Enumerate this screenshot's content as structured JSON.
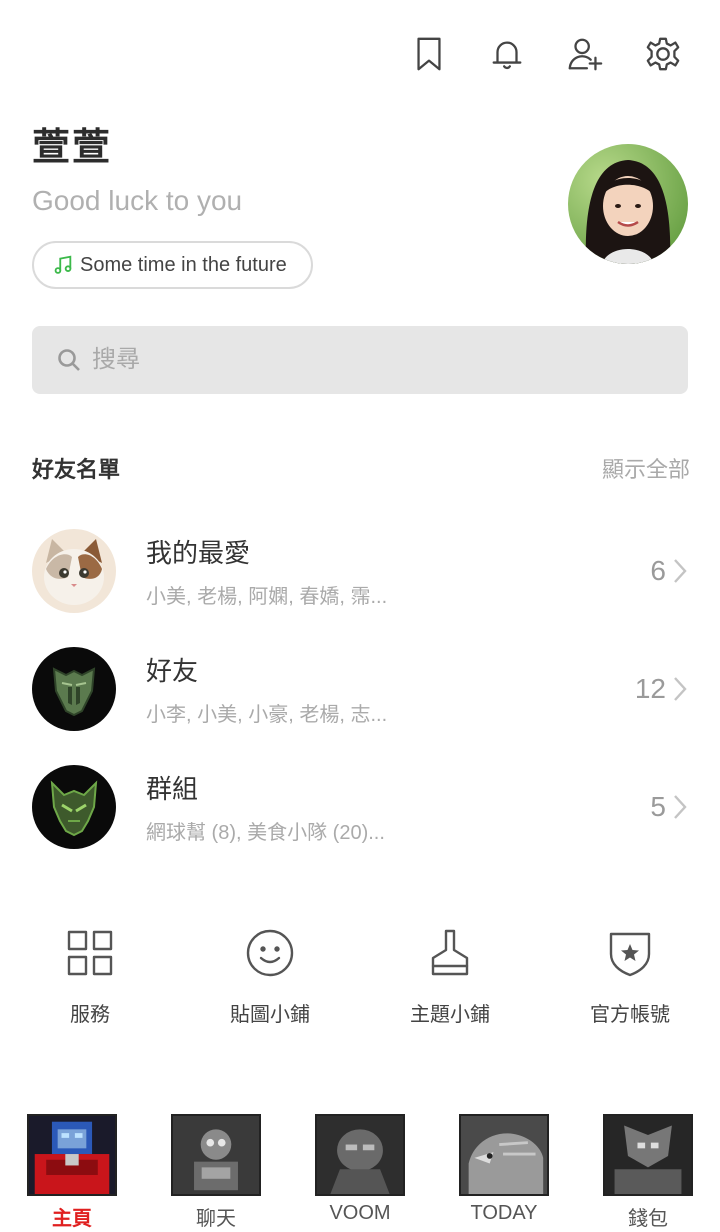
{
  "header": {
    "icons": [
      "bookmark-icon",
      "bell-icon",
      "add-friend-icon",
      "gear-icon"
    ]
  },
  "profile": {
    "name": "萱萱",
    "status": "Good luck to you",
    "music": "Some time in the future",
    "music_icon": "music-note-icon"
  },
  "search": {
    "placeholder": "搜尋"
  },
  "friends_section": {
    "title": "好友名單",
    "show_all": "顯示全部",
    "rows": [
      {
        "title": "我的最愛",
        "subtitle": "小美, 老楊, 阿嫻, 春嬌, 霈...",
        "count": "6"
      },
      {
        "title": "好友",
        "subtitle": "小李, 小美, 小豪, 老楊, 志...",
        "count": "12"
      },
      {
        "title": "群組",
        "subtitle": "網球幫 (8), 美食小隊 (20)...",
        "count": "5"
      }
    ]
  },
  "services": [
    {
      "label": "服務",
      "icon": "grid-icon"
    },
    {
      "label": "貼圖小鋪",
      "icon": "smiley-icon"
    },
    {
      "label": "主題小鋪",
      "icon": "brush-icon"
    },
    {
      "label": "官方帳號",
      "icon": "shield-star-icon"
    }
  ],
  "bottom_nav": [
    {
      "label": "主頁",
      "active": true
    },
    {
      "label": "聊天",
      "active": false
    },
    {
      "label": "VOOM",
      "active": false
    },
    {
      "label": "TODAY",
      "active": false
    },
    {
      "label": "錢包",
      "active": false
    }
  ],
  "colors": {
    "accent_active": "#e02020",
    "music_icon": "#3cb94a",
    "search_bg": "#e6e6e6"
  }
}
